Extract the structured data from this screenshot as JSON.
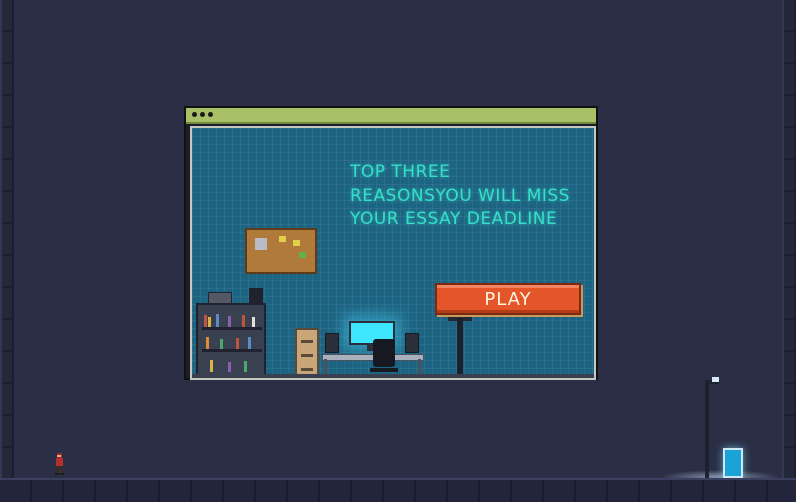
{
  "banner": {
    "title_lines": [
      "TOP THREE",
      "REASONSYOU WILL MISS",
      "YOUR ESSAY DEADLINE"
    ],
    "play_label": "PLAY"
  },
  "colors": {
    "background": "#2b2f45",
    "titlebar": "#a9c166",
    "screen": "#1d6483",
    "title_text": "#36e0c8",
    "play_button": "#e4562a"
  },
  "icons": {
    "window_controls": [
      "dot",
      "dot",
      "dot"
    ],
    "player": "player-character-sprite",
    "door": "exit-door",
    "lamp": "street-lamp"
  }
}
